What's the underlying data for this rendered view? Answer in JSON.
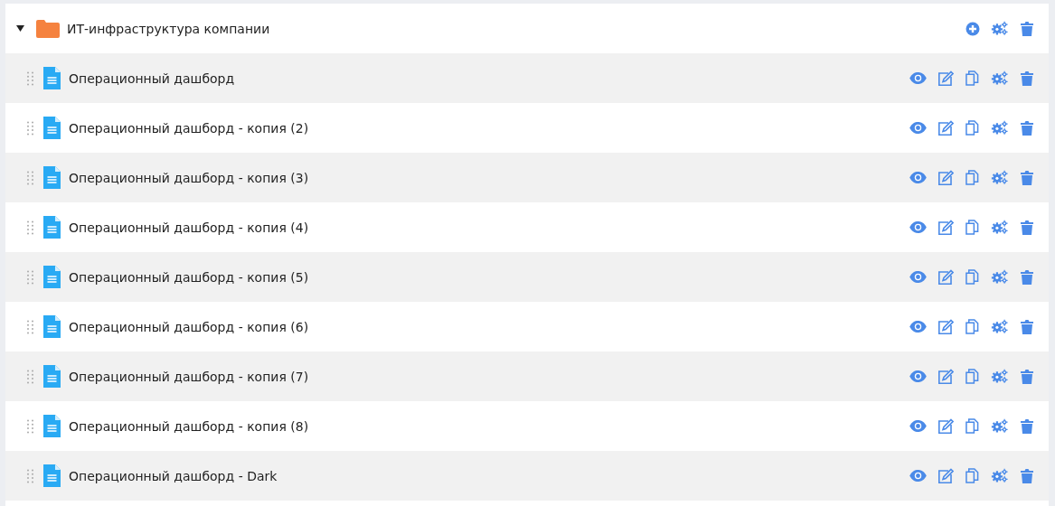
{
  "folder": {
    "name": "ИТ-инфраструктура компании",
    "expanded": true,
    "children": [
      {
        "title": "Операционный дашборд"
      },
      {
        "title": "Операционный дашборд - копия (2)"
      },
      {
        "title": "Операционный дашборд - копия (3)"
      },
      {
        "title": "Операционный дашборд - копия (4)"
      },
      {
        "title": "Операционный дашборд - копия (5)"
      },
      {
        "title": "Операционный дашборд - копия (6)"
      },
      {
        "title": "Операционный дашборд - копия (7)"
      },
      {
        "title": "Операционный дашборд - копия (8)"
      },
      {
        "title": "Операционный дашборд - Dark"
      }
    ]
  }
}
